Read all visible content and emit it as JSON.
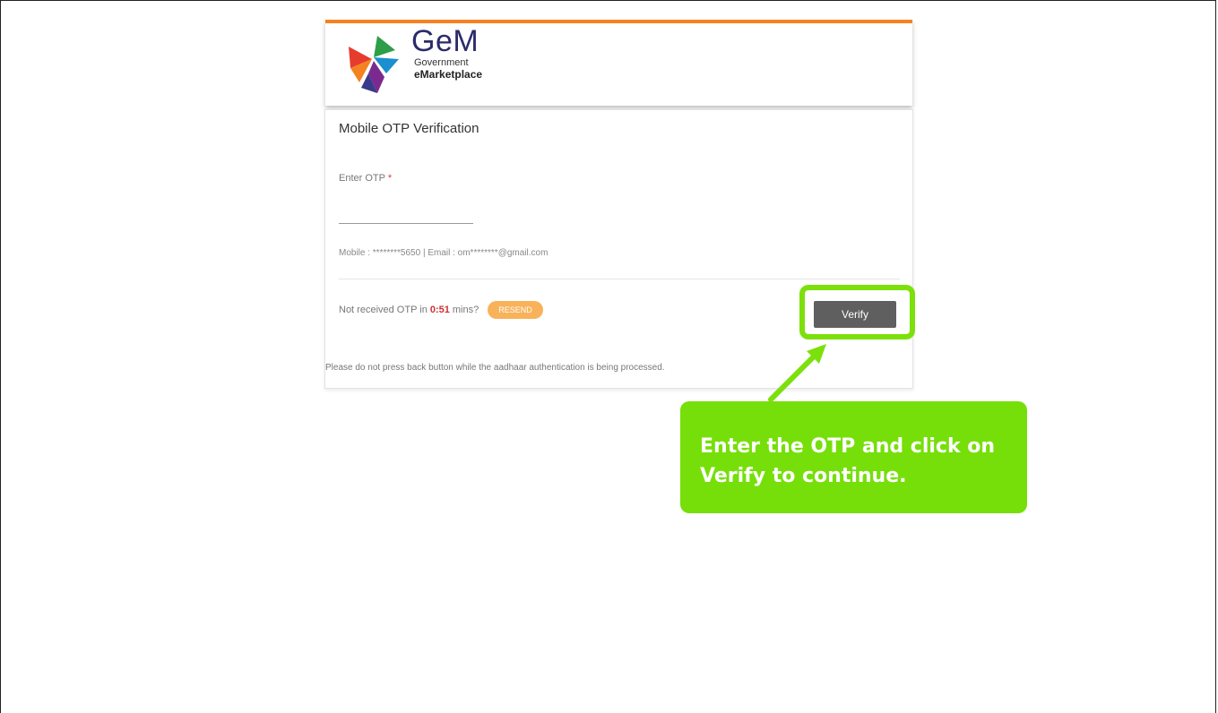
{
  "brand": {
    "name": "GeM",
    "line1": "Government",
    "line2": "eMarketplace",
    "accent_color": "#f58220"
  },
  "form": {
    "title": "Mobile OTP Verification",
    "otp_label": "Enter OTP",
    "required_mark": "*",
    "otp_value": "",
    "contact_info": "Mobile : ********5650 | Email : om********@gmail.com",
    "not_received_text": "Not received OTP in",
    "timer": "0:51",
    "mins_text": "mins?",
    "resend_label": "RESEND",
    "verify_label": "Verify",
    "notice": "Please do not press back button while the aadhaar authentication is being processed."
  },
  "annotation": {
    "callout_text": "Enter the OTP and click on Verify  to continue.",
    "highlight_color": "#7ce00b"
  }
}
